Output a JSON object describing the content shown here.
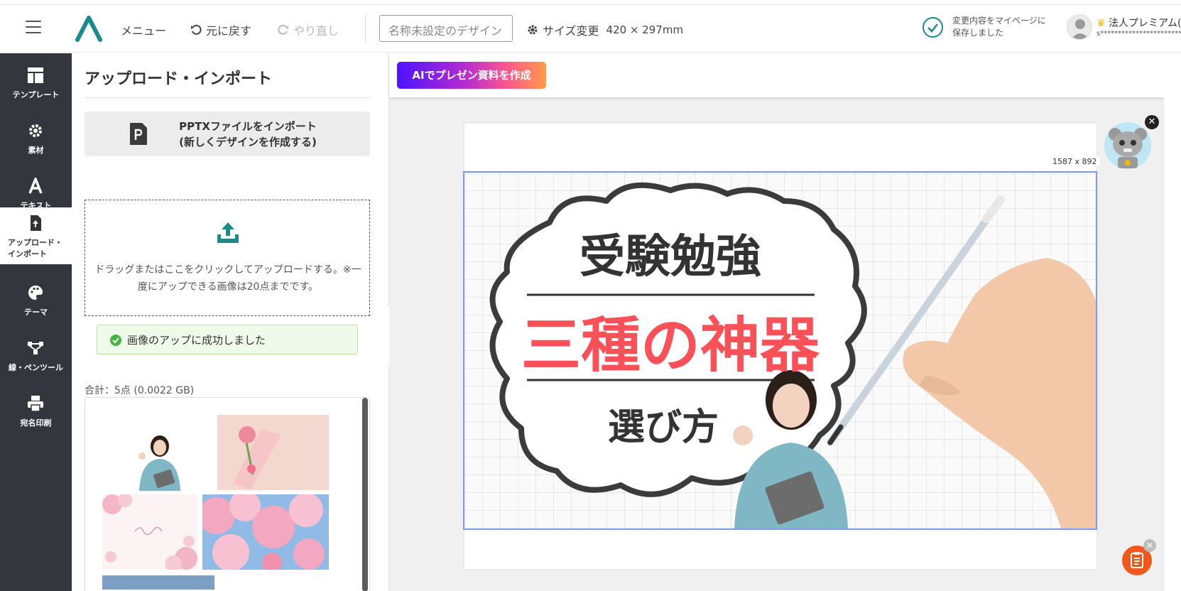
{
  "header": {
    "menu_label": "メニュー",
    "undo_label": "元に戻す",
    "redo_label": "やり直し",
    "design_name_placeholder": "名称未設定のデザイン",
    "resize_label": "サイズ変更",
    "size_value": "420 × 297mm",
    "save_status_line1": "変更内容をマイページに",
    "save_status_line2": "保存しました",
    "user_name": "法人プレミアム(",
    "user_email": "s****************************"
  },
  "sidebar": {
    "items": [
      {
        "label": "テンプレート",
        "icon": "template-icon"
      },
      {
        "label": "素材",
        "icon": "material-icon"
      },
      {
        "label": "テキスト",
        "icon": "text-icon"
      },
      {
        "label": "アップロード・インポート",
        "label_line1": "アップロード・",
        "label_line2": "インポート",
        "icon": "upload-icon",
        "active": true
      },
      {
        "label": "テーマ",
        "icon": "palette-icon"
      },
      {
        "label": "線・ペンツール",
        "icon": "pen-tool-icon"
      },
      {
        "label": "宛名印刷",
        "icon": "printer-icon"
      }
    ]
  },
  "panel": {
    "title": "アップロード・インポート",
    "pptx_line1": "PPTXファイルをインポート",
    "pptx_line2": "(新しくデザインを作成する)",
    "drop_text": "ドラッグまたはここをクリックしてアップロードする。※一度にアップできる画像は20点までです。",
    "success_message": "画像のアップに成功しました",
    "total": "合計：5点 (0.0022 GB)"
  },
  "workspace": {
    "ai_button": "AIでプレゼン資料を作成",
    "canvas_size_label": "1587 x 892"
  },
  "design": {
    "heading": "受験勉強",
    "headline": "三種の神器",
    "subheading": "選び方"
  },
  "colors": {
    "sidebar_bg": "#33363d",
    "accent_teal": "#1a8a8a",
    "headline_red": "#fa5058",
    "selection_blue": "#7f9bea",
    "fab_orange": "#f0581e"
  }
}
